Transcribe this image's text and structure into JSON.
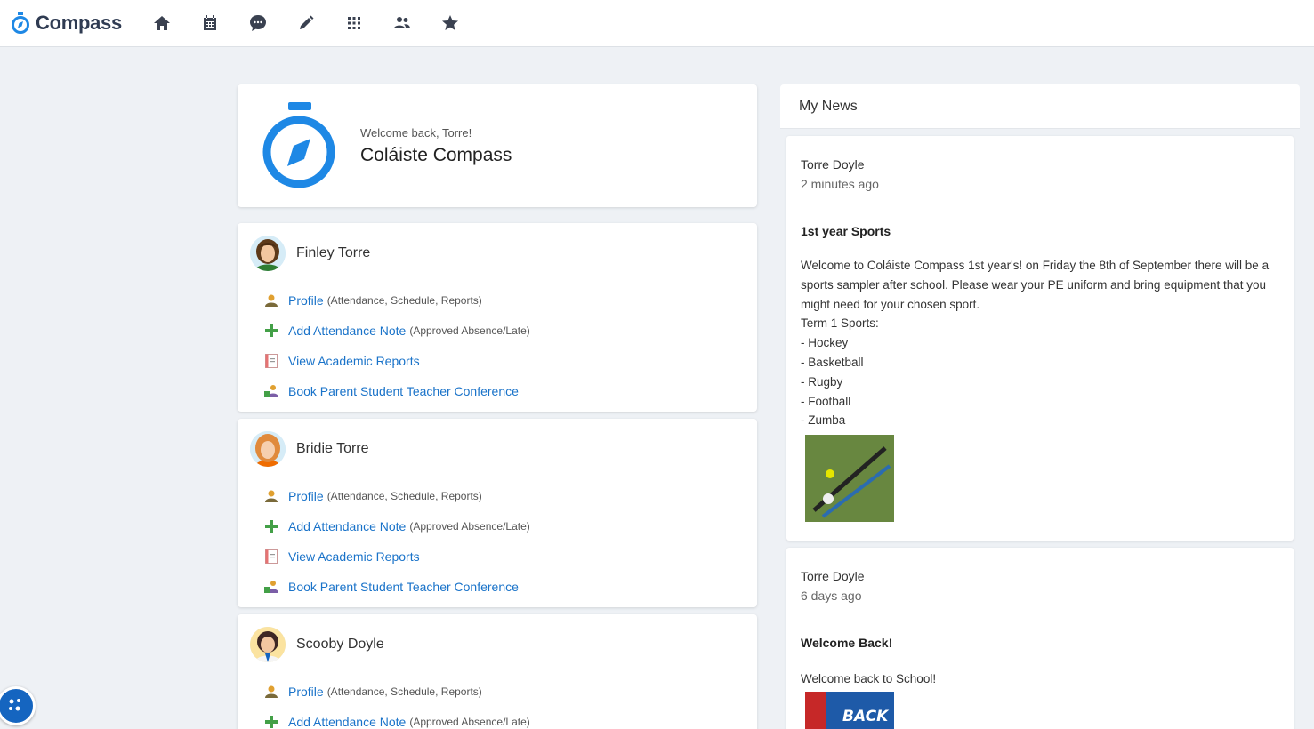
{
  "brand": {
    "name": "Compass"
  },
  "nav": [
    {
      "icon": "home-icon"
    },
    {
      "icon": "calendar-icon"
    },
    {
      "icon": "chat-icon"
    },
    {
      "icon": "pencil-icon"
    },
    {
      "icon": "apps-grid-icon"
    },
    {
      "icon": "people-icon"
    },
    {
      "icon": "star-icon"
    }
  ],
  "welcome": {
    "greeting": "Welcome back, Torre!",
    "school": "Coláiste Compass"
  },
  "students": [
    {
      "name": "Finley Torre",
      "links": [
        {
          "label": "Profile",
          "note": "(Attendance, Schedule, Reports)",
          "icon": "profile-icon"
        },
        {
          "label": "Add Attendance Note",
          "note": "(Approved Absence/Late)",
          "icon": "plus-icon"
        },
        {
          "label": "View Academic Reports",
          "note": "",
          "icon": "report-icon"
        },
        {
          "label": "Book Parent Student Teacher Conference",
          "note": "",
          "icon": "conference-icon"
        }
      ]
    },
    {
      "name": "Bridie Torre",
      "links": [
        {
          "label": "Profile",
          "note": "(Attendance, Schedule, Reports)",
          "icon": "profile-icon"
        },
        {
          "label": "Add Attendance Note",
          "note": "(Approved Absence/Late)",
          "icon": "plus-icon"
        },
        {
          "label": "View Academic Reports",
          "note": "",
          "icon": "report-icon"
        },
        {
          "label": "Book Parent Student Teacher Conference",
          "note": "",
          "icon": "conference-icon"
        }
      ]
    },
    {
      "name": "Scooby Doyle",
      "links": [
        {
          "label": "Profile",
          "note": "(Attendance, Schedule, Reports)",
          "icon": "profile-icon"
        },
        {
          "label": "Add Attendance Note",
          "note": "(Approved Absence/Late)",
          "icon": "plus-icon"
        }
      ]
    }
  ],
  "news": {
    "header": "My News",
    "items": [
      {
        "author": "Torre Doyle",
        "time": "2 minutes ago",
        "title": "1st year Sports",
        "body": [
          "Welcome to Coláiste Compass 1st year's! on Friday the 8th of September there will be a",
          "sports sampler after school. Please wear your PE uniform and bring equipment that you",
          "might need for your chosen sport.",
          "Term 1 Sports:",
          "- Hockey",
          "- Basketball",
          "- Rugby",
          "- Football",
          "- Zumba"
        ]
      },
      {
        "author": "Torre Doyle",
        "time": "6 days ago",
        "title": "Welcome Back!",
        "body": [
          "Welcome back to School!"
        ],
        "image_text": "BACK"
      }
    ]
  },
  "colors": {
    "accent": "#1a73c9",
    "compass_blue": "#1e88e5",
    "background": "#eef1f5"
  }
}
